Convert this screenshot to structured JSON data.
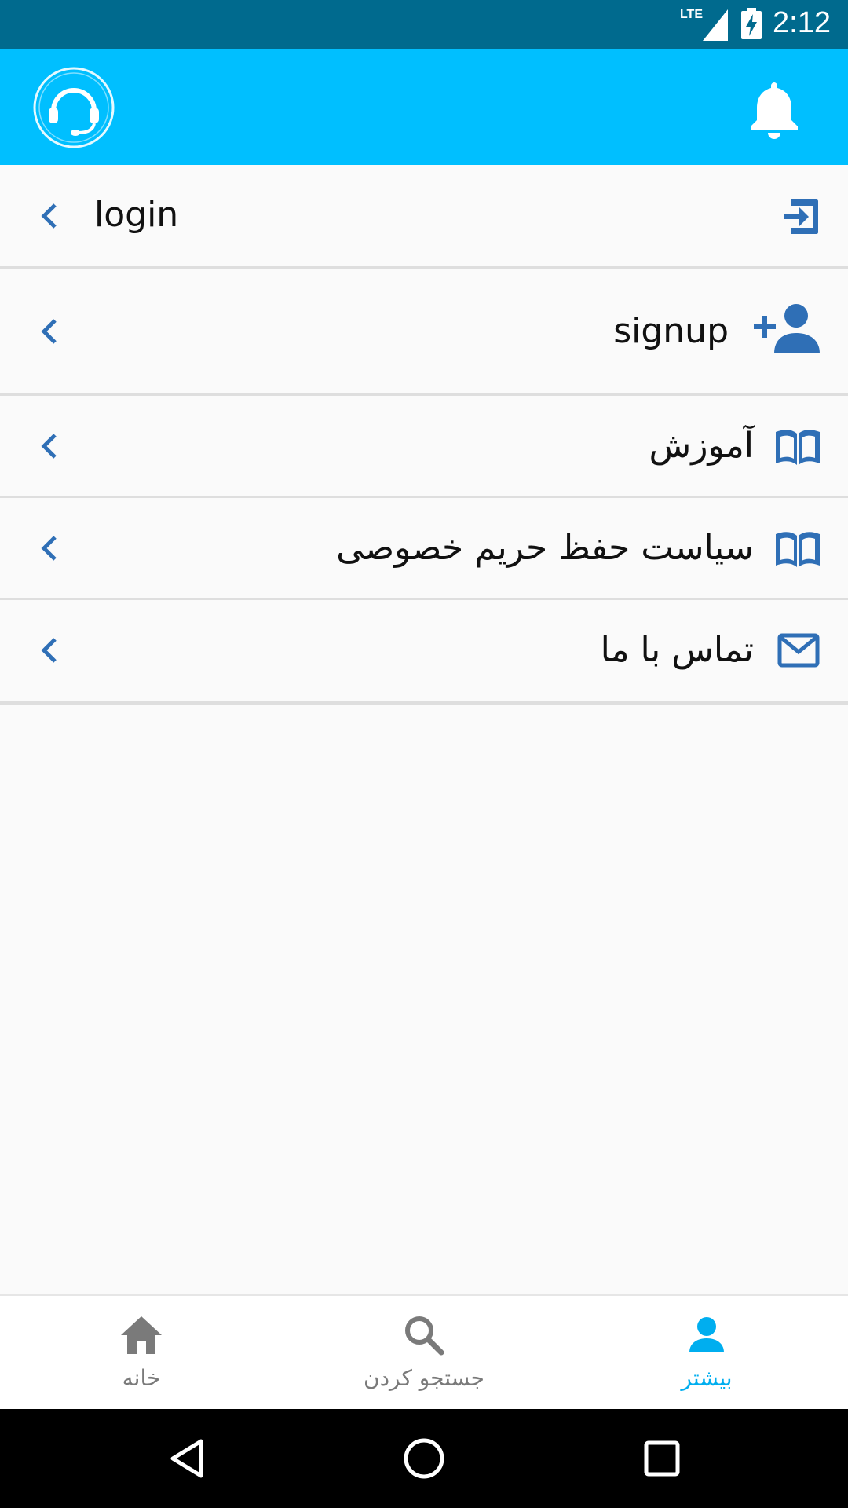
{
  "status_bar": {
    "time": "2:12",
    "network": "LTE",
    "icons": [
      "signal-icon",
      "battery-charging-icon"
    ]
  },
  "app_bar": {
    "background": "#00bfff",
    "logo_icon": "headset-logo-icon",
    "notification_icon": "bell-icon"
  },
  "menu": {
    "items": [
      {
        "label": "login",
        "icon": "login-icon"
      },
      {
        "label": "signup",
        "icon": "add-user-icon"
      },
      {
        "label": "آموزش",
        "icon": "book-icon"
      },
      {
        "label": "سیاست حفظ حریم خصوصی",
        "icon": "book-icon"
      },
      {
        "label": "تماس با ما",
        "icon": "mail-icon"
      }
    ],
    "icon_color": "#2f6fb6"
  },
  "bottom_nav": {
    "items": [
      {
        "label": "خانه",
        "icon": "home-icon",
        "active": false
      },
      {
        "label": "جستجو کردن",
        "icon": "search-icon",
        "active": false
      },
      {
        "label": "بیشتر",
        "icon": "person-icon",
        "active": true
      }
    ],
    "active_color": "#00aeef",
    "inactive_color": "#7a7a7a"
  },
  "system_nav": {
    "icons": [
      "back-icon",
      "home-circle-icon",
      "recents-icon"
    ]
  }
}
